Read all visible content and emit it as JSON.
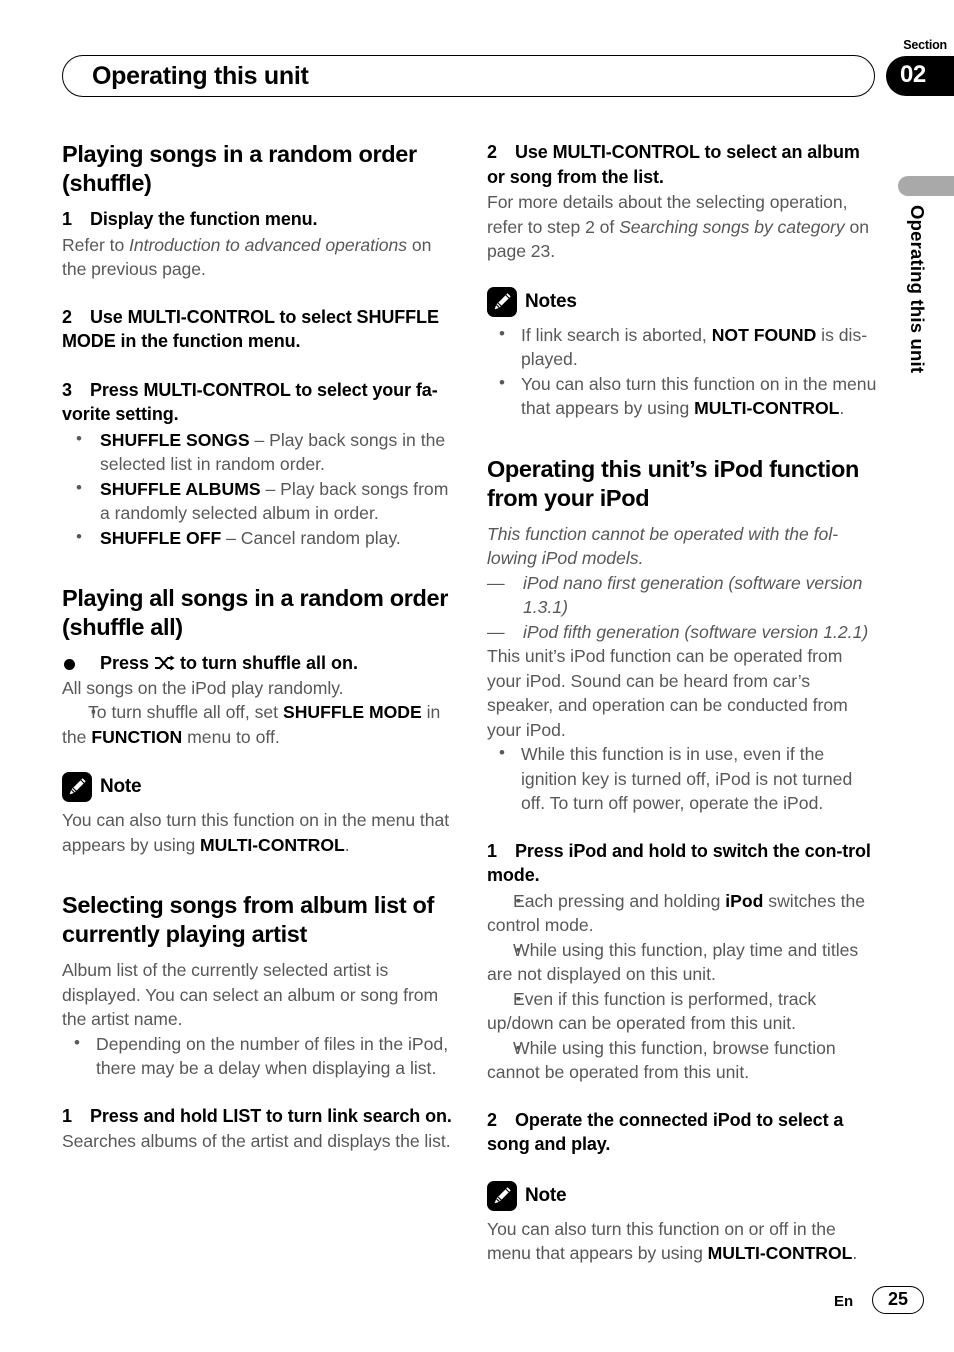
{
  "header": {
    "title": "Operating this unit",
    "section_label": "Section",
    "section_number": "02"
  },
  "side": {
    "running_head": "Operating this unit"
  },
  "footer": {
    "language": "En",
    "page_number": "25"
  },
  "left_column": {
    "section1": {
      "heading": "Playing songs in a random order (shuffle)",
      "step1": {
        "num": "1",
        "text": "Display the function menu."
      },
      "step1_body_pre": "Refer to ",
      "step1_body_italic": "Introduction to advanced operations",
      "step1_body_post": " on the previous page.",
      "step2": {
        "num": "2",
        "text": "Use MULTI-CONTROL to select SHUFFLE MODE in the function menu."
      },
      "step3": {
        "num": "3",
        "text": "Press MULTI-CONTROL to select your fa-vorite setting."
      },
      "bullets": [
        {
          "term": "SHUFFLE SONGS",
          "desc": " – Play back songs in the selected list in random order."
        },
        {
          "term": "SHUFFLE ALBUMS",
          "desc": " – Play back songs from a randomly selected album in order."
        },
        {
          "term": "SHUFFLE OFF",
          "desc": " – Cancel random play."
        }
      ]
    },
    "section2": {
      "heading": "Playing all songs in a random order (shuffle all)",
      "bullet_step_pre": "Press ",
      "bullet_step_icon": "shuffle-icon",
      "bullet_step_post": " to turn shuffle all on.",
      "body": "All songs on the iPod play randomly.",
      "square_note_pre": "To turn shuffle all off, set ",
      "square_note_bold1": "SHUFFLE MODE",
      "square_note_mid": " in the ",
      "square_note_bold2": "FUNCTION",
      "square_note_post": " menu to off.",
      "note": {
        "label": "Note",
        "text_pre": "You can also turn this function on in the menu that appears by using ",
        "text_bold": "MULTI-CONTROL",
        "text_post": "."
      }
    },
    "section3": {
      "heading": "Selecting songs from album list of currently playing artist",
      "body": "Album list of the currently selected artist is displayed. You can select an album or song from the artist name.",
      "bullet": "Depending on the number of files in the iPod, there may be a delay when displaying a list.",
      "step1": {
        "num": "1",
        "text": "Press and hold LIST to turn link search on."
      },
      "step1_body": "Searches albums of the artist and displays the list."
    }
  },
  "right_column": {
    "section1": {
      "step2": {
        "num": "2",
        "text": "Use MULTI-CONTROL to select an album or song from the list."
      },
      "body_pre": "For more details about the selecting operation, refer to step 2 of ",
      "body_italic": "Searching songs by category",
      "body_post": " on page 23.",
      "notes": {
        "label": "Notes",
        "items": [
          {
            "pre": "If link search is aborted, ",
            "bold": "NOT FOUND",
            "post": " is dis-played."
          },
          {
            "pre": "You can also turn this function on in the menu that appears by using ",
            "bold": "MULTI-CONTROL",
            "post": "."
          }
        ]
      }
    },
    "section2": {
      "heading": "Operating this unit’s iPod function from your iPod",
      "intro_italic": "This function cannot be operated with the fol-lowing iPod models.",
      "model_list": [
        "iPod nano first generation (software version 1.3.1)",
        "iPod fifth generation (software version 1.2.1)"
      ],
      "body": "This unit’s iPod function can be operated from your iPod. Sound can be heard from car’s speaker, and operation can be conducted from your iPod.",
      "bullet": "While this function is in use, even if the ignition key is turned off, iPod is not turned off. To turn off power, operate the iPod.",
      "step1": {
        "num": "1",
        "text": "Press iPod and hold to switch the con-trol mode."
      },
      "squares": [
        {
          "pre": "Each pressing and holding ",
          "bold": "iPod",
          "post": " switches the control mode."
        },
        {
          "pre": "While using this function, play time and titles are not displayed on this unit.",
          "bold": "",
          "post": ""
        },
        {
          "pre": "Even if this function is performed, track up/down can be operated from this unit.",
          "bold": "",
          "post": ""
        },
        {
          "pre": "While using this function, browse function cannot be operated from this unit.",
          "bold": "",
          "post": ""
        }
      ],
      "step2": {
        "num": "2",
        "text": "Operate the connected iPod to select a song and play."
      },
      "note": {
        "label": "Note",
        "text_pre": "You can also turn this function on or off in the menu that appears by using ",
        "text_bold": "MULTI-CONTROL",
        "text_post": "."
      }
    }
  },
  "colors": {
    "body_text": "#58585a",
    "heading_text": "#000000",
    "side_tab": "#a9a9a9"
  }
}
